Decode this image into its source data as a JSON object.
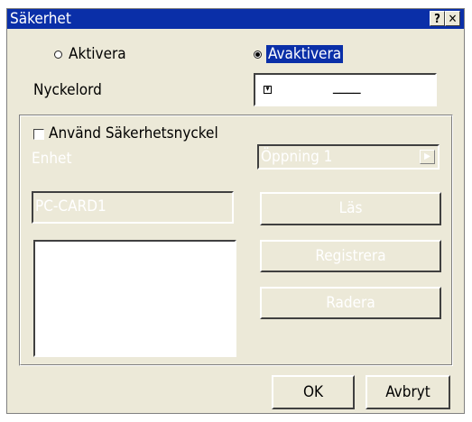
{
  "window": {
    "title": "Säkerhet",
    "help_label": "?",
    "close_label": "✕"
  },
  "mode": {
    "activate_label": "Aktivera",
    "deactivate_label": "Avaktivera",
    "selected": "Avaktivera"
  },
  "keyword": {
    "label": "Nyckelord",
    "value": "____"
  },
  "security_key": {
    "checkbox_label": "Använd Säkerhetsnyckel",
    "checked": false,
    "device_label": "Enhet",
    "device_value": "Öppning 1",
    "card_name": "PC-CARD1",
    "read_button": "Läs",
    "register_button": "Registrera",
    "delete_button": "Radera"
  },
  "footer": {
    "ok_button": "OK",
    "cancel_button": "Avbryt"
  },
  "colors": {
    "title_bar": "#0a2fa8",
    "dialog_bg": "#ece9d8",
    "disabled_text": "#ffffff"
  }
}
